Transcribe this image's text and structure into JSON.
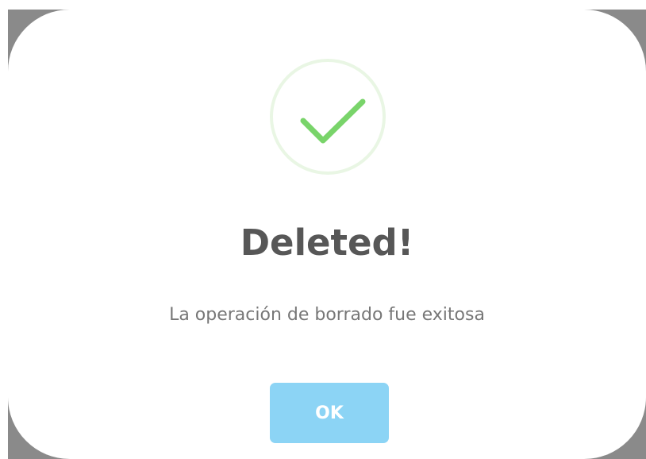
{
  "dialog": {
    "title": "Deleted!",
    "message": "La operación de borrado fue exitosa",
    "confirm_label": "OK",
    "icon": "success-check-icon"
  },
  "colors": {
    "accent": "#8CD4F5",
    "success": "#79D46A",
    "success_ring": "#E9F6E4",
    "title_text": "#575757",
    "message_text": "#777777",
    "backdrop": "#8A8A8A"
  }
}
